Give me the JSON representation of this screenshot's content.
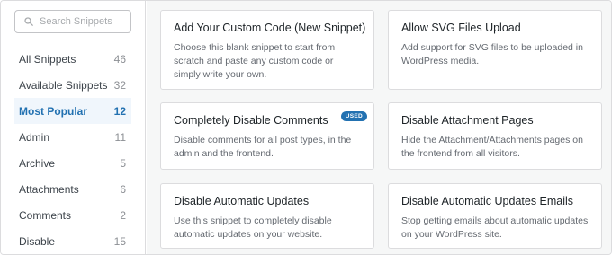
{
  "search": {
    "placeholder": "Search Snippets"
  },
  "categories": [
    {
      "label": "All Snippets",
      "count": "46"
    },
    {
      "label": "Available Snippets",
      "count": "32"
    },
    {
      "label": "Most Popular",
      "count": "12"
    },
    {
      "label": "Admin",
      "count": "11"
    },
    {
      "label": "Archive",
      "count": "5"
    },
    {
      "label": "Attachments",
      "count": "6"
    },
    {
      "label": "Comments",
      "count": "2"
    },
    {
      "label": "Disable",
      "count": "15"
    }
  ],
  "active_category": "Most Popular",
  "snippets": [
    {
      "title": "Add Your Custom Code (New Snippet)",
      "description": "Choose this blank snippet to start from scratch and paste any custom code or simply write your own."
    },
    {
      "title": "Allow SVG Files Upload",
      "description": "Add support for SVG files to be uploaded in WordPress media."
    },
    {
      "title": "Completely Disable Comments",
      "description": "Disable comments for all post types, in the admin and the frontend.",
      "badge": "USED"
    },
    {
      "title": "Disable Attachment Pages",
      "description": "Hide the Attachment/Attachments pages on the frontend from all visitors."
    },
    {
      "title": "Disable Automatic Updates",
      "description": "Use this snippet to completely disable automatic updates on your website."
    },
    {
      "title": "Disable Automatic Updates Emails",
      "description": "Stop getting emails about automatic updates on your WordPress site."
    }
  ],
  "colors": {
    "accent": "#2271b1",
    "active_bg": "#f0f6fc",
    "main_bg": "#f6f7f7",
    "border": "#dcdcde"
  },
  "icons": {
    "search": "search-icon"
  }
}
